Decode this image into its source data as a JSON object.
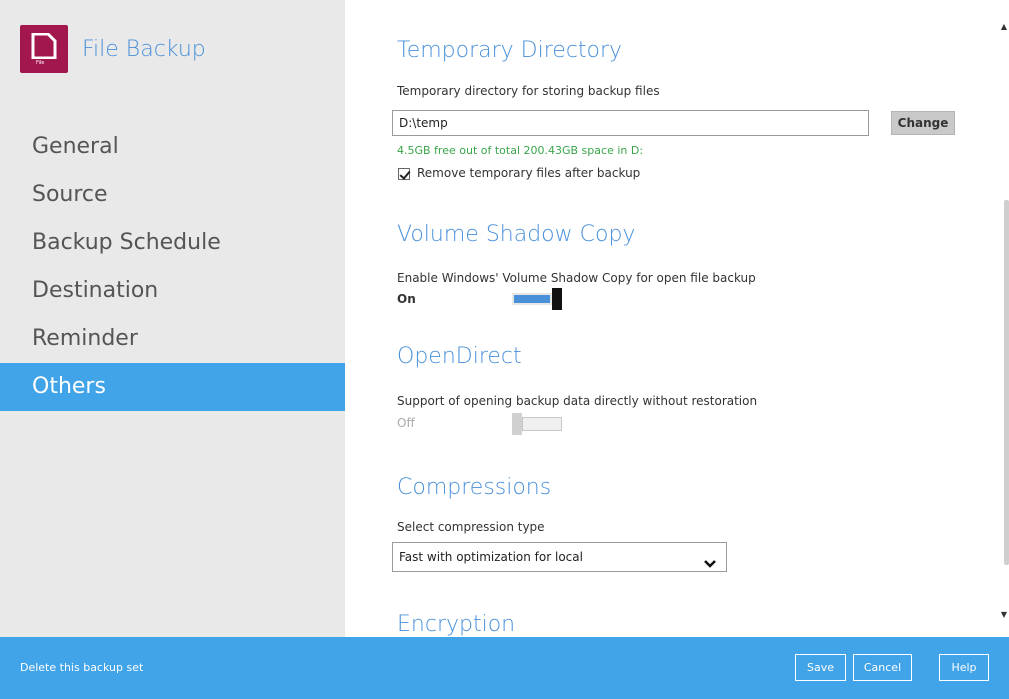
{
  "app": {
    "title": "File Backup",
    "logo_tag": "File"
  },
  "sidebar": {
    "items": [
      {
        "label": "General"
      },
      {
        "label": "Source"
      },
      {
        "label": "Backup Schedule"
      },
      {
        "label": "Destination"
      },
      {
        "label": "Reminder"
      },
      {
        "label": "Others",
        "active": true
      }
    ]
  },
  "temporary_directory": {
    "title": "Temporary Directory",
    "description": "Temporary directory for storing backup files",
    "path_value": "D:\\temp",
    "change_label": "Change",
    "free_space": "4.5GB free out of total 200.43GB space in D:",
    "remove_temp_label": "Remove temporary files after backup",
    "remove_temp_checked": true
  },
  "volume_shadow_copy": {
    "title": "Volume Shadow Copy",
    "description": "Enable Windows' Volume Shadow Copy for open file backup",
    "state_label": "On",
    "enabled": true
  },
  "open_direct": {
    "title": "OpenDirect",
    "description": "Support of opening backup data directly without restoration",
    "state_label": "Off",
    "enabled": false
  },
  "compressions": {
    "title": "Compressions",
    "description": "Select compression type",
    "selected": "Fast with optimization for local"
  },
  "encryption": {
    "title": "Encryption"
  },
  "footer": {
    "delete_label": "Delete this backup set",
    "save_label": "Save",
    "cancel_label": "Cancel",
    "help_label": "Help"
  },
  "colors": {
    "accent": "#41a3e8",
    "title_blue": "#4a90d9",
    "logo": "#a3174f",
    "free_space_green": "#3aa64a"
  }
}
